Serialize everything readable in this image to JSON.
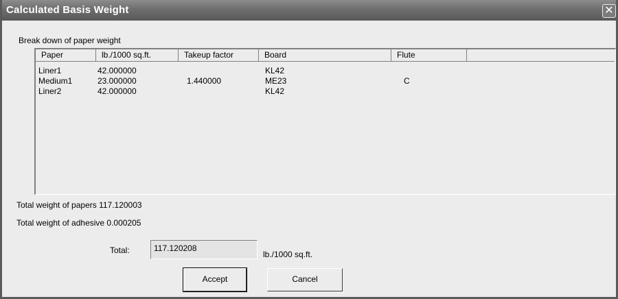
{
  "window": {
    "title": "Calculated Basis Weight",
    "close_glyph": "✕"
  },
  "group_label": "Break down of paper weight",
  "table": {
    "columns": [
      "Paper",
      "lb./1000 sq.ft.",
      "Takeup factor",
      "Board",
      "Flute"
    ],
    "rows": [
      {
        "paper": "Liner1",
        "weight": "42.000000",
        "takeup": "",
        "board": "KL42",
        "flute": ""
      },
      {
        "paper": "Medium1",
        "weight": "23.000000",
        "takeup": "1.440000",
        "board": "ME23",
        "flute": "C"
      },
      {
        "paper": "Liner2",
        "weight": "42.000000",
        "takeup": "",
        "board": "KL42",
        "flute": ""
      }
    ]
  },
  "totals": {
    "papers_text": "Total weight of papers 117.120003",
    "adhesive_text": "Total weight of adhesive 0.000205",
    "total_label": "Total:",
    "total_value": "117.120208",
    "unit": "lb./1000 sq.ft."
  },
  "buttons": {
    "accept": "Accept",
    "cancel": "Cancel"
  }
}
